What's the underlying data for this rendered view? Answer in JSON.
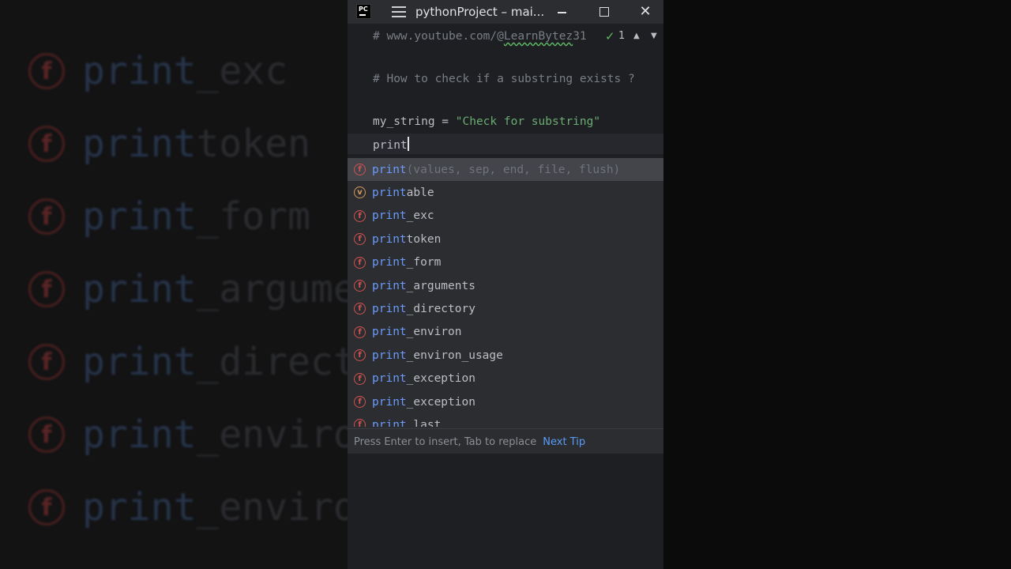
{
  "background_zoom": {
    "items": [
      {
        "kind": "f",
        "match": "print",
        "rest": "_exc"
      },
      {
        "kind": "f",
        "match": "print",
        "rest": "token"
      },
      {
        "kind": "f",
        "match": "print",
        "rest": "_form"
      },
      {
        "kind": "f",
        "match": "print",
        "rest": "_argume"
      },
      {
        "kind": "f",
        "match": "print",
        "rest": "_direct"
      },
      {
        "kind": "f",
        "match": "print",
        "rest": "_enviro"
      },
      {
        "kind": "f",
        "match": "print",
        "rest": "_enviro"
      }
    ]
  },
  "window": {
    "app_icon_text": "PC",
    "title": "pythonProject – mai...",
    "close_symbol": "✕"
  },
  "inspections": {
    "check_symbol": "✓",
    "count": "1",
    "up_symbol": "▲",
    "down_symbol": "▼"
  },
  "editor": {
    "lines": {
      "url_comment_prefix": "# www.youtube.com/@",
      "url_comment_handle": "LearnBytez",
      "url_comment_suffix": "31",
      "question_comment": "# How to check if a substring exists ?",
      "assign_var": "my_string = ",
      "assign_str": "\"Check for substring\"",
      "typed": "print"
    }
  },
  "completion": {
    "items": [
      {
        "kind": "f",
        "match": "print",
        "rest": "",
        "signature": "(values, sep, end, file, flush)",
        "selected": true
      },
      {
        "kind": "v",
        "match": "print",
        "rest": "able",
        "signature": ""
      },
      {
        "kind": "f",
        "match": "print",
        "rest": "_exc",
        "signature": ""
      },
      {
        "kind": "f",
        "match": "print",
        "rest": "token",
        "signature": ""
      },
      {
        "kind": "f",
        "match": "print",
        "rest": "_form",
        "signature": ""
      },
      {
        "kind": "f",
        "match": "print",
        "rest": "_arguments",
        "signature": ""
      },
      {
        "kind": "f",
        "match": "print",
        "rest": "_directory",
        "signature": ""
      },
      {
        "kind": "f",
        "match": "print",
        "rest": "_environ",
        "signature": ""
      },
      {
        "kind": "f",
        "match": "print",
        "rest": "_environ_usage",
        "signature": ""
      },
      {
        "kind": "f",
        "match": "print",
        "rest": "_exception",
        "signature": ""
      },
      {
        "kind": "f",
        "match": "print",
        "rest": "_exception",
        "signature": ""
      },
      {
        "kind": "f",
        "match": "print",
        "rest": "_last",
        "signature": ""
      }
    ],
    "hint": "Press Enter to insert, Tab to replace",
    "next_tip": "Next Tip"
  },
  "colors": {
    "editor_bg": "#1e1f22",
    "popup_bg": "#2b2d30",
    "match": "#6b9bfa",
    "string": "#6aab73",
    "comment": "#7a7e85",
    "function_badge": "#d25252",
    "variable_badge": "#d5995a"
  }
}
